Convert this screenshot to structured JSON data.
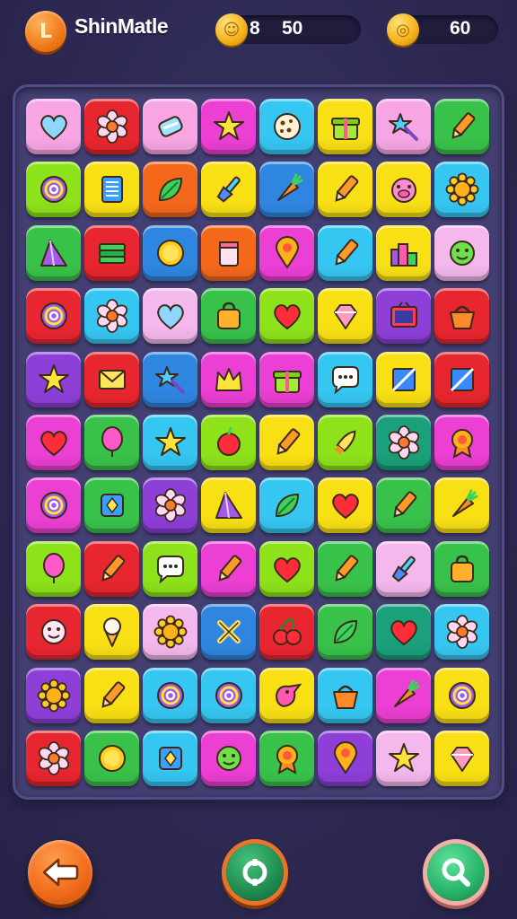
{
  "header": {
    "title": "ShinMatle",
    "logo_glyph": "L",
    "moves_value": "8",
    "coins_value": "50",
    "gems_value": "60"
  },
  "colors": {
    "pink": "#f7a6e3",
    "red": "#e8262f",
    "lime": "#8ee21a",
    "magenta": "#ec3fd4",
    "cyan": "#36c6f2",
    "yellow": "#f9e015",
    "green": "#39c24a",
    "orange": "#f4681c",
    "blue": "#2f86e0",
    "purple": "#8d3fd8",
    "darkblue": "#2b5fc9",
    "lpink": "#f4b8ec",
    "teal": "#1aa07a"
  },
  "board": {
    "rows": [
      [
        [
          "pink",
          "heart-icon"
        ],
        [
          "red",
          "flower-icon"
        ],
        [
          "pink",
          "candy-icon"
        ],
        [
          "magenta",
          "star-icon"
        ],
        [
          "cyan",
          "cookie-icon"
        ],
        [
          "yellow",
          "gift-icon"
        ],
        [
          "pink",
          "star-wand-icon"
        ],
        [
          "green",
          "pencil-icon"
        ]
      ],
      [
        [
          "lime",
          "spiral-icon"
        ],
        [
          "yellow",
          "notebook-icon"
        ],
        [
          "orange",
          "leaf-icon"
        ],
        [
          "yellow",
          "paintbrush-icon"
        ],
        [
          "blue",
          "carrot-icon"
        ],
        [
          "yellow",
          "pencil-icon"
        ],
        [
          "yellow",
          "pig-face-icon"
        ],
        [
          "cyan",
          "sun-icon"
        ]
      ],
      [
        [
          "green",
          "crystal-icon"
        ],
        [
          "red",
          "book-stack-icon"
        ],
        [
          "blue",
          "coin-icon"
        ],
        [
          "orange",
          "jar-icon"
        ],
        [
          "magenta",
          "pin-icon"
        ],
        [
          "cyan",
          "pencil-icon"
        ],
        [
          "yellow",
          "buildings-icon"
        ],
        [
          "lpink",
          "smiley-icon"
        ]
      ],
      [
        [
          "red",
          "spiral-icon"
        ],
        [
          "cyan",
          "flower-icon"
        ],
        [
          "lpink",
          "heart-icon"
        ],
        [
          "green",
          "bag-icon"
        ],
        [
          "lime",
          "heart-icon"
        ],
        [
          "yellow",
          "gem-icon"
        ],
        [
          "purple",
          "tv-icon"
        ],
        [
          "red",
          "basket-icon"
        ]
      ],
      [
        [
          "purple",
          "star-icon"
        ],
        [
          "red",
          "envelope-icon"
        ],
        [
          "blue",
          "star-wand-icon"
        ],
        [
          "magenta",
          "crown-icon"
        ],
        [
          "magenta",
          "gift-icon"
        ],
        [
          "cyan",
          "speech-bubble-icon"
        ],
        [
          "yellow",
          "flag-icon"
        ],
        [
          "red",
          "flag-icon"
        ]
      ],
      [
        [
          "magenta",
          "heart-icon"
        ],
        [
          "green",
          "balloon-icon"
        ],
        [
          "cyan",
          "star-icon"
        ],
        [
          "lime",
          "apple-icon"
        ],
        [
          "yellow",
          "pencil-icon"
        ],
        [
          "lime",
          "rocket-icon"
        ],
        [
          "teal",
          "flower-icon"
        ],
        [
          "magenta",
          "badge-icon"
        ]
      ],
      [
        [
          "magenta",
          "spiral-icon"
        ],
        [
          "green",
          "box-icon"
        ],
        [
          "purple",
          "flower-icon"
        ],
        [
          "yellow",
          "crystal-icon"
        ],
        [
          "cyan",
          "leaf-icon"
        ],
        [
          "yellow",
          "heart-icon"
        ],
        [
          "green",
          "pencil-icon"
        ],
        [
          "yellow",
          "carrot-icon"
        ]
      ],
      [
        [
          "lime",
          "balloon-icon"
        ],
        [
          "red",
          "pencil-icon"
        ],
        [
          "lime",
          "speech-bubble-icon"
        ],
        [
          "magenta",
          "pencil-icon"
        ],
        [
          "lime",
          "heart-icon"
        ],
        [
          "green",
          "pencil-icon"
        ],
        [
          "lpink",
          "paintbrush-icon"
        ],
        [
          "green",
          "bag-icon"
        ]
      ],
      [
        [
          "red",
          "smiley-icon"
        ],
        [
          "yellow",
          "ice-cream-icon"
        ],
        [
          "lpink",
          "sun-icon"
        ],
        [
          "blue",
          "cross-icon"
        ],
        [
          "red",
          "cherry-icon"
        ],
        [
          "green",
          "leaf-icon"
        ],
        [
          "teal",
          "heart-icon"
        ],
        [
          "cyan",
          "flower-icon"
        ]
      ],
      [
        [
          "purple",
          "sun-icon"
        ],
        [
          "yellow",
          "pencil-icon"
        ],
        [
          "cyan",
          "spiral-icon"
        ],
        [
          "cyan",
          "spiral-icon"
        ],
        [
          "yellow",
          "bird-icon"
        ],
        [
          "cyan",
          "basket-icon"
        ],
        [
          "magenta",
          "carrot-icon"
        ],
        [
          "yellow",
          "spiral-icon"
        ]
      ],
      [
        [
          "red",
          "flower-icon"
        ],
        [
          "green",
          "coin-icon"
        ],
        [
          "cyan",
          "box-icon"
        ],
        [
          "magenta",
          "smiley-icon"
        ],
        [
          "green",
          "badge-icon"
        ],
        [
          "purple",
          "pin-icon"
        ],
        [
          "lpink",
          "star-icon"
        ],
        [
          "yellow",
          "gem-icon"
        ]
      ]
    ]
  },
  "footer": {
    "back_icon": "back-arrow-icon",
    "middle_icon": "refresh-icon",
    "search_icon": "magnifier-icon"
  }
}
